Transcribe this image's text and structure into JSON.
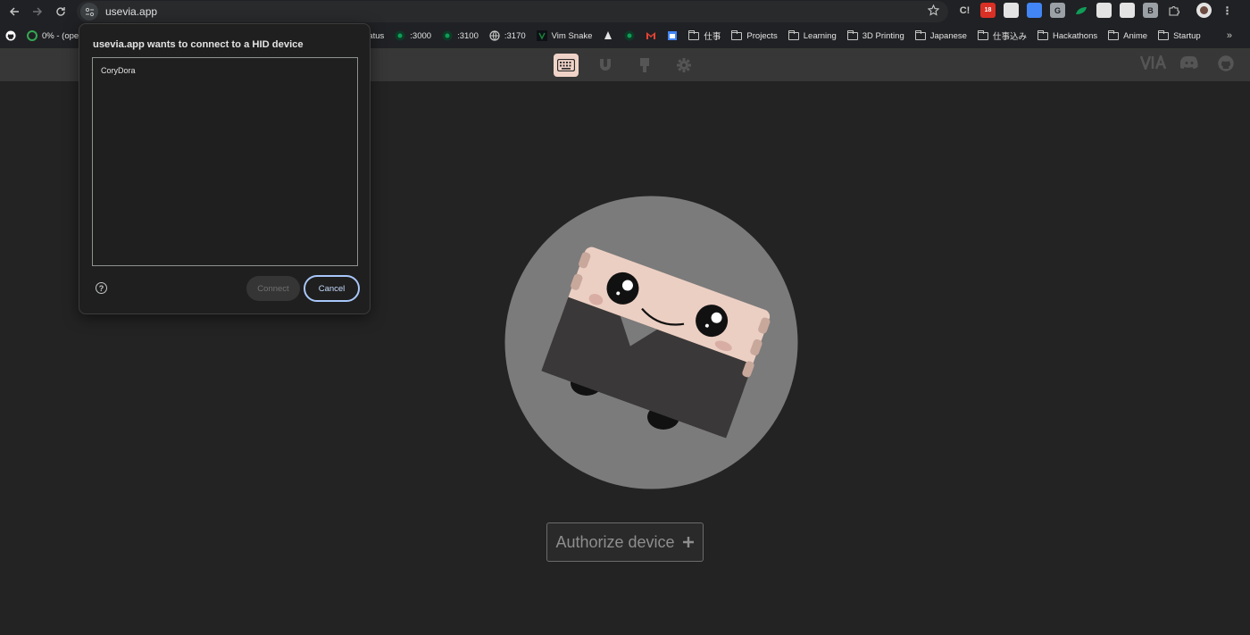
{
  "browser": {
    "url": "usevia.app",
    "bookmarks": [
      {
        "label": "",
        "icon": "github-icon",
        "color": "#ffffff"
      },
      {
        "label": "0% - (oper",
        "icon": "progress-icon",
        "color": "#34a853"
      },
      {
        "label": "Status",
        "icon": "",
        "color": ""
      },
      {
        "label": ":3000",
        "icon": "dev-icon",
        "color": "#0f9d58"
      },
      {
        "label": ":3100",
        "icon": "dev-icon",
        "color": "#0f9d58"
      },
      {
        "label": ":3170",
        "icon": "globe-icon",
        "color": "#c4c7c5"
      },
      {
        "label": "Vim Snake",
        "icon": "vim-icon",
        "color": "#1a7f37"
      },
      {
        "label": "",
        "icon": "sail-icon",
        "color": "#e3e3e3"
      },
      {
        "label": "",
        "icon": "dev-icon",
        "color": "#0f9d58"
      },
      {
        "label": "",
        "icon": "gmail-icon",
        "color": "#ea4335"
      },
      {
        "label": "",
        "icon": "calendar-icon",
        "color": "#4285f4"
      },
      {
        "label": "仕事",
        "icon": "folder-icon",
        "color": ""
      },
      {
        "label": "Projects",
        "icon": "folder-icon",
        "color": ""
      },
      {
        "label": "Learning",
        "icon": "folder-icon",
        "color": ""
      },
      {
        "label": "3D Printing",
        "icon": "folder-icon",
        "color": ""
      },
      {
        "label": "Japanese",
        "icon": "folder-icon",
        "color": ""
      },
      {
        "label": "仕事込み",
        "icon": "folder-icon",
        "color": ""
      },
      {
        "label": "Hackathons",
        "icon": "folder-icon",
        "color": ""
      },
      {
        "label": "Anime",
        "icon": "folder-icon",
        "color": ""
      },
      {
        "label": "Startup",
        "icon": "folder-icon",
        "color": ""
      }
    ],
    "extensions": [
      {
        "label": "C!",
        "color": "#c4c7c5"
      },
      {
        "label": "18",
        "color": "#d93025"
      },
      {
        "label": "",
        "color": "#e3e3e3"
      },
      {
        "label": "",
        "color": "#4285f4"
      },
      {
        "label": "G",
        "color": "#9aa0a6"
      },
      {
        "label": "",
        "color": "#0f9d58"
      },
      {
        "label": "",
        "color": "#e3e3e3"
      },
      {
        "label": "",
        "color": "#e3e3e3"
      },
      {
        "label": "B",
        "color": "#9aa0a6"
      }
    ]
  },
  "dialog": {
    "title": "usevia.app wants to connect to a HID device",
    "devices": [
      "CoryDora"
    ],
    "connect_label": "Connect",
    "cancel_label": "Cancel"
  },
  "app": {
    "authorize_label": "Authorize device",
    "authorize_icon": "plus-icon"
  }
}
